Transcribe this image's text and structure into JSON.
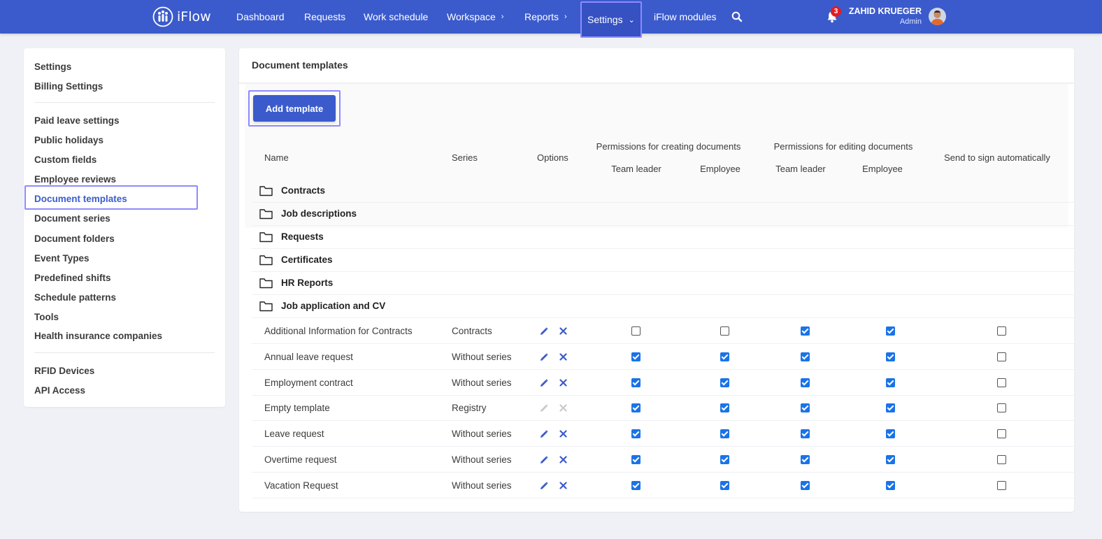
{
  "app": {
    "brand": "iFlow"
  },
  "nav": {
    "items": [
      {
        "label": "Dashboard",
        "chevron": ""
      },
      {
        "label": "Requests",
        "chevron": ""
      },
      {
        "label": "Work schedule",
        "chevron": ""
      },
      {
        "label": "Workspace",
        "chevron": "›"
      },
      {
        "label": "Reports",
        "chevron": "›"
      },
      {
        "label": "Settings",
        "chevron": "⌄"
      },
      {
        "label": "iFlow modules",
        "chevron": ""
      }
    ],
    "active": "Settings",
    "search_icon": "search-icon"
  },
  "user": {
    "name": "ZAHID KRUEGER",
    "role": "Admin",
    "notifications": "3"
  },
  "sidebar": {
    "groups": [
      [
        "Settings",
        "Billing Settings"
      ],
      [
        "Paid leave settings",
        "Public holidays",
        "Custom fields",
        "Employee reviews",
        "Document templates",
        "Document series",
        "Document folders",
        "Event Types",
        "Predefined shifts",
        "Schedule patterns",
        "Tools",
        "Health insurance companies"
      ],
      [
        "RFID Devices",
        "API Access"
      ]
    ],
    "active": "Document templates"
  },
  "page": {
    "title": "Document templates",
    "add_button": "Add template"
  },
  "table": {
    "headers": {
      "name": "Name",
      "series": "Series",
      "options": "Options",
      "perm_create": "Permissions for creating documents",
      "perm_edit": "Permissions for editing documents",
      "team_leader": "Team leader",
      "employee": "Employee",
      "send_sign": "Send to sign automatically"
    },
    "folders": [
      "Contracts",
      "Job descriptions",
      "Requests",
      "Certificates",
      "HR Reports",
      "Job application and CV"
    ],
    "rows": [
      {
        "name": "Additional Information for Contracts",
        "series": "Contracts",
        "actions_enabled": true,
        "create_tl": false,
        "create_emp": false,
        "edit_tl": true,
        "edit_emp": true,
        "send_sign": false
      },
      {
        "name": "Annual leave request",
        "series": "Without series",
        "actions_enabled": true,
        "create_tl": true,
        "create_emp": true,
        "edit_tl": true,
        "edit_emp": true,
        "send_sign": false
      },
      {
        "name": "Employment contract",
        "series": "Without series",
        "actions_enabled": true,
        "create_tl": true,
        "create_emp": true,
        "edit_tl": true,
        "edit_emp": true,
        "send_sign": false
      },
      {
        "name": "Empty template",
        "series": "Registry",
        "actions_enabled": false,
        "create_tl": true,
        "create_emp": true,
        "edit_tl": true,
        "edit_emp": true,
        "send_sign": false
      },
      {
        "name": "Leave request",
        "series": "Without series",
        "actions_enabled": true,
        "create_tl": true,
        "create_emp": true,
        "edit_tl": true,
        "edit_emp": true,
        "send_sign": false
      },
      {
        "name": "Overtime request",
        "series": "Without series",
        "actions_enabled": true,
        "create_tl": true,
        "create_emp": true,
        "edit_tl": true,
        "edit_emp": true,
        "send_sign": false
      },
      {
        "name": "Vacation Request",
        "series": "Without series",
        "actions_enabled": true,
        "create_tl": true,
        "create_emp": true,
        "edit_tl": true,
        "edit_emp": true,
        "send_sign": false
      }
    ]
  },
  "colors": {
    "brand": "#3b5bcc",
    "highlight": "#8f8aff",
    "checkbox": "#1a73e8",
    "badge": "#e31b23"
  }
}
